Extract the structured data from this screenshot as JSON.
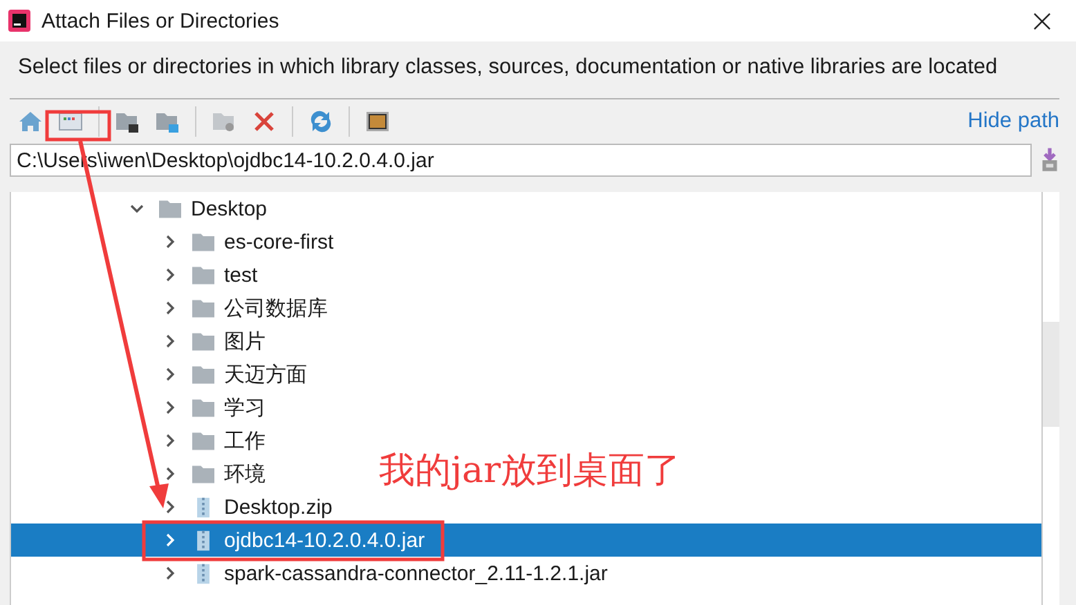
{
  "window": {
    "title": "Attach Files or Directories"
  },
  "description": "Select files or directories in which library classes, sources, documentation or native libraries are located",
  "toolbar": [
    {
      "kind": "home"
    },
    {
      "kind": "window"
    },
    {
      "kind": "folder-dark"
    },
    {
      "kind": "folder-blue"
    },
    {
      "kind": "folder-new"
    },
    {
      "kind": "delete"
    },
    {
      "kind": "refresh"
    },
    {
      "kind": "square"
    }
  ],
  "hide_path_link": "Hide path",
  "path_field": {
    "value": "C:\\Users\\iwen\\Desktop\\ojdbc14-10.2.0.4.0.jar"
  },
  "tree": [
    {
      "label": "Desktop",
      "kind": "folder",
      "expanded": true,
      "selected": false,
      "children": [
        {
          "label": "es-core-first",
          "kind": "folder",
          "expanded": false,
          "selected": false
        },
        {
          "label": "test",
          "kind": "folder",
          "expanded": false,
          "selected": false
        },
        {
          "label": "公司数据库",
          "kind": "folder",
          "expanded": false,
          "selected": false
        },
        {
          "label": "图片",
          "kind": "folder",
          "expanded": false,
          "selected": false
        },
        {
          "label": "天迈方面",
          "kind": "folder",
          "expanded": false,
          "selected": false
        },
        {
          "label": "学习",
          "kind": "folder",
          "expanded": false,
          "selected": false
        },
        {
          "label": "工作",
          "kind": "folder",
          "expanded": false,
          "selected": false
        },
        {
          "label": "环境",
          "kind": "folder",
          "expanded": false,
          "selected": false
        },
        {
          "label": "Desktop.zip",
          "kind": "archive",
          "expanded": false,
          "selected": false
        },
        {
          "label": "ojdbc14-10.2.0.4.0.jar",
          "kind": "archive",
          "expanded": false,
          "selected": true
        },
        {
          "label": "spark-cassandra-connector_2.11-1.2.1.jar",
          "kind": "archive",
          "expanded": false,
          "selected": false
        }
      ]
    }
  ],
  "annotation": {
    "text": "我的jar放到桌面了"
  }
}
